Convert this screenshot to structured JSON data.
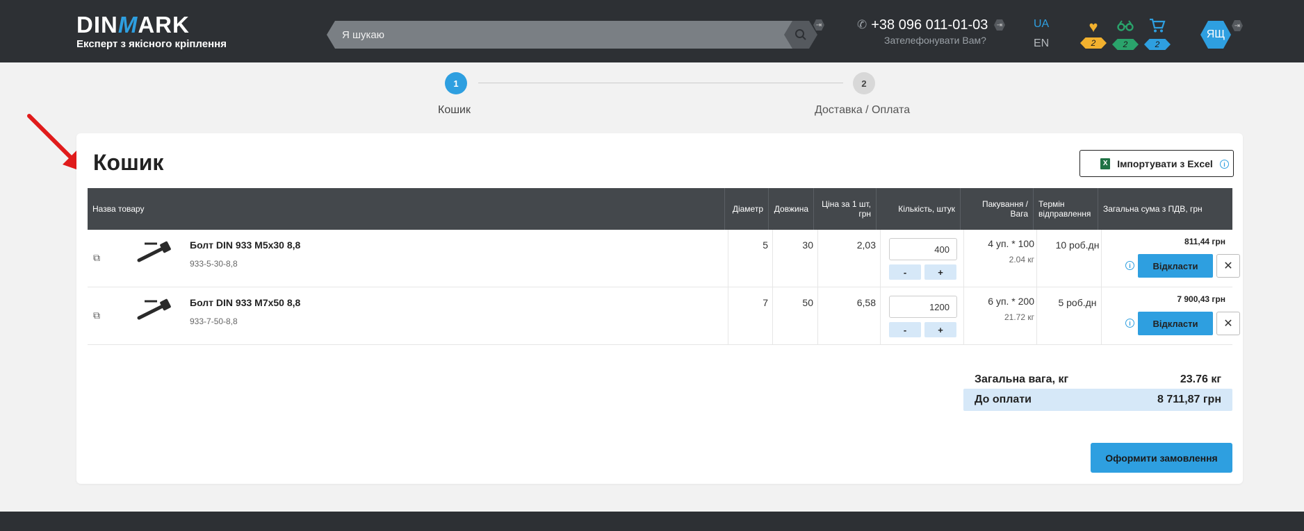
{
  "header": {
    "logo_word_start": "DIN",
    "logo_word_m": "M",
    "logo_word_end": "ARK",
    "logo_tagline": "Експерт з якісного кріплення",
    "search_placeholder": "Я шукаю",
    "phone": "+38 096 011-01-03",
    "callback_label": "Зателефонувати Вам?",
    "lang_active": "UA",
    "lang_other": "EN",
    "favorites_count": "2",
    "compare_count": "2",
    "cart_count": "2",
    "avatar_initials": "ЯЩ",
    "colors": {
      "favorites": "#f2b12e",
      "compare": "#2aa36b",
      "cart": "#2e9fe0",
      "accent": "#2e9fe0"
    }
  },
  "steps": [
    {
      "number": "1",
      "label": "Кошик"
    },
    {
      "number": "2",
      "label": "Доставка / Оплата"
    }
  ],
  "cart": {
    "title": "Кошик",
    "import_label": "Імпортувати з Excel",
    "columns": {
      "name": "Назва товару",
      "diameter": "Діаметр",
      "length": "Довжина",
      "price": "Ціна за 1 шт, грн",
      "qty": "Кількість, штук",
      "packing": "Пакування / Вага",
      "term": "Термін відправлення",
      "total": "Загальна сума з ПДВ, грн"
    },
    "items": [
      {
        "name": "Болт DIN 933 M5x30 8,8",
        "sku": "933-5-30-8,8",
        "diameter": "5",
        "length": "30",
        "price": "2,03",
        "qty": "400",
        "packing": "4 уп. * 100",
        "weight": "2.04 кг",
        "term": "10 роб.дн",
        "total": "811,44 грн"
      },
      {
        "name": "Болт DIN 933 M7x50 8,8",
        "sku": "933-7-50-8,8",
        "diameter": "7",
        "length": "50",
        "price": "6,58",
        "qty": "1200",
        "packing": "6 уп. * 200",
        "weight": "21.72 кг",
        "term": "5 роб.дн",
        "total": "7 900,43 грн"
      }
    ],
    "minus_label": "-",
    "plus_label": "+",
    "postpone_label": "Відкласти",
    "remove_label": "✕",
    "total_weight_label": "Загальна вага, кг",
    "total_weight_value": "23.76 кг",
    "to_pay_label": "До оплати",
    "to_pay_value": "8 711,87 грн",
    "order_label": "Оформити замовлення"
  }
}
